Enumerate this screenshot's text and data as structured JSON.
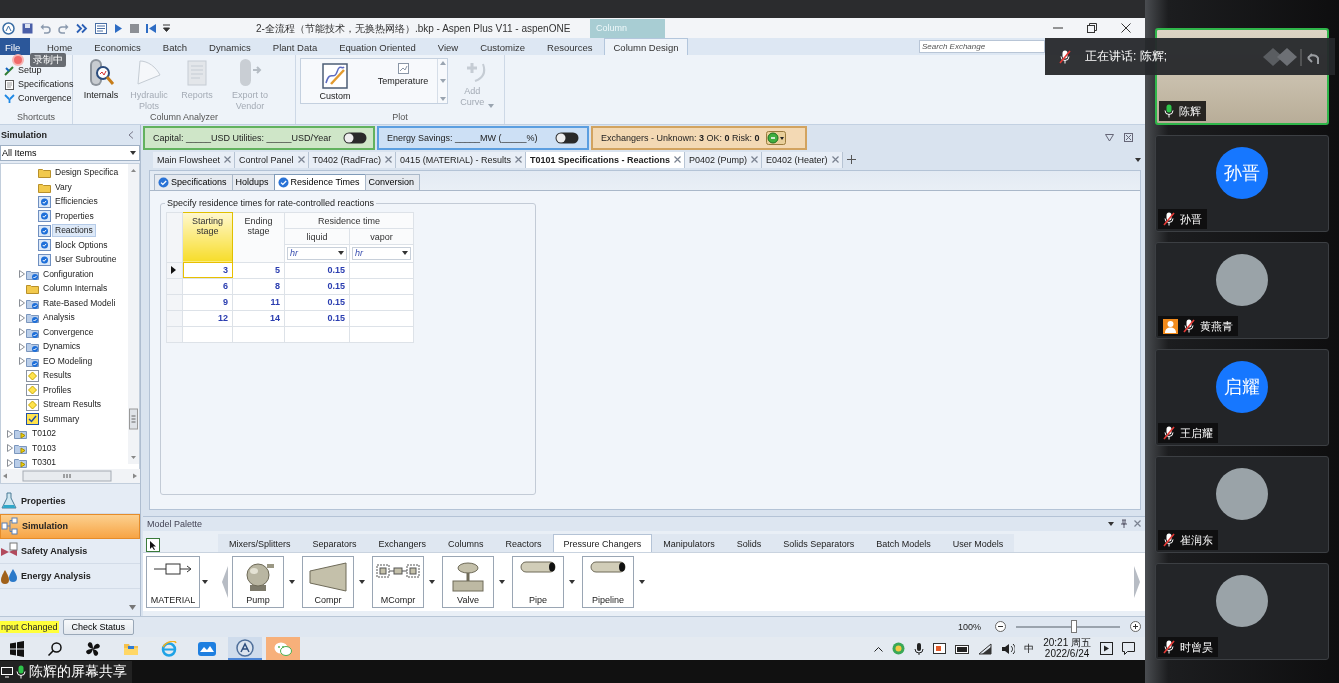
{
  "title_bar": {
    "title": "2-全流程（节能技术，无换热网络）.bkp - Aspen Plus V11 - aspenONE",
    "context_tab": "Column"
  },
  "recording": {
    "label": "录制中"
  },
  "ribbon_tabs": [
    {
      "label": "File",
      "kind": "file",
      "selected": false
    },
    {
      "label": "Home",
      "kind": "tab",
      "selected": false
    },
    {
      "label": "Economics",
      "kind": "tab",
      "selected": false
    },
    {
      "label": "Batch",
      "kind": "tab",
      "selected": false
    },
    {
      "label": "Dynamics",
      "kind": "tab",
      "selected": false
    },
    {
      "label": "Plant Data",
      "kind": "tab",
      "selected": false
    },
    {
      "label": "Equation Oriented",
      "kind": "tab",
      "selected": false
    },
    {
      "label": "View",
      "kind": "tab",
      "selected": false
    },
    {
      "label": "Customize",
      "kind": "tab",
      "selected": false
    },
    {
      "label": "Resources",
      "kind": "tab",
      "selected": false
    },
    {
      "label": "Column Design",
      "kind": "tab",
      "selected": true
    }
  ],
  "search": {
    "placeholder": "Search Exchange"
  },
  "ribbon_groups": [
    {
      "label": "Shortcuts",
      "kind": "small",
      "items": [
        {
          "label": "Setup",
          "disabled": false
        },
        {
          "label": "Specifications",
          "disabled": false
        },
        {
          "label": "Convergence",
          "disabled": false
        }
      ]
    },
    {
      "label": "Column Analyzer",
      "kind": "large",
      "items": [
        {
          "label": "Internals",
          "disabled": false
        },
        {
          "label": "Hydraulic Plots",
          "disabled": true
        },
        {
          "label": "Reports",
          "disabled": true
        },
        {
          "label": "Export to Vendor",
          "disabled": true
        }
      ]
    },
    {
      "label": "Plot",
      "kind": "gallery",
      "items": [
        {
          "label": "Custom",
          "disabled": false
        },
        {
          "label": "Temperature",
          "disabled": false
        },
        {
          "label": "Add Curve",
          "disabled": true
        }
      ]
    }
  ],
  "navigator": {
    "title": "Simulation",
    "filter": "All Items",
    "tree": [
      {
        "children": [
          {
            "children": [
              {
                "label": "Design Specifica",
                "kind": "folder",
                "expandable": false,
                "selected": false
              },
              {
                "label": "Vary",
                "kind": "folder",
                "expandable": false,
                "selected": false
              },
              {
                "label": "Efficiencies",
                "kind": "form",
                "expandable": false,
                "selected": false
              },
              {
                "label": "Properties",
                "kind": "form",
                "expandable": false,
                "selected": false
              },
              {
                "label": "Reactions",
                "kind": "form",
                "expandable": false,
                "selected": true
              },
              {
                "label": "Block Options",
                "kind": "form",
                "expandable": false,
                "selected": false
              },
              {
                "label": "User Subroutine",
                "kind": "form",
                "expandable": false,
                "selected": false
              }
            ]
          },
          {
            "label": "Configuration",
            "kind": "folder-check",
            "expandable": true,
            "selected": false
          },
          {
            "label": "Column Internals",
            "kind": "folder",
            "expandable": false,
            "selected": false
          },
          {
            "label": "Rate-Based Modeli",
            "kind": "folder-check",
            "expandable": true,
            "selected": false
          },
          {
            "label": "Analysis",
            "kind": "folder-check",
            "expandable": true,
            "selected": false
          },
          {
            "label": "Convergence",
            "kind": "folder-check",
            "expandable": true,
            "selected": false
          },
          {
            "label": "Dynamics",
            "kind": "folder-check",
            "expandable": true,
            "selected": false
          },
          {
            "label": "EO Modeling",
            "kind": "folder-check",
            "expandable": true,
            "selected": false
          },
          {
            "label": "Results",
            "kind": "result",
            "expandable": false,
            "selected": false
          },
          {
            "label": "Profiles",
            "kind": "result",
            "expandable": false,
            "selected": false
          },
          {
            "label": "Stream Results",
            "kind": "result",
            "expandable": false,
            "selected": false
          },
          {
            "label": "Summary",
            "kind": "summary",
            "expandable": false,
            "selected": false
          }
        ]
      },
      {
        "label": "T0102",
        "kind": "block",
        "expandable": true,
        "selected": false
      },
      {
        "label": "T0103",
        "kind": "block",
        "expandable": true,
        "selected": false
      },
      {
        "label": "T0301",
        "kind": "block",
        "expandable": true,
        "selected": false
      }
    ],
    "modules": [
      {
        "label": "Properties",
        "selected": false
      },
      {
        "label": "Simulation",
        "selected": true
      },
      {
        "label": "Safety Analysis",
        "selected": false
      },
      {
        "label": "Energy Analysis",
        "selected": false
      }
    ]
  },
  "energy_bar": {
    "panels": [
      {
        "kind": "toggle",
        "text": "Capital: _____USD   Utilities: _____USD/Year",
        "color": "#cfe6c8",
        "on": false
      },
      {
        "kind": "toggle",
        "text": "Energy Savings: _____MW    (_____%)",
        "color": "#cde0f5",
        "on": false
      },
      {
        "kind": "status",
        "text": "Exchangers -   Unknown: **3**   OK: **0**   Risk: **0**",
        "color": "#f3d9b4"
      }
    ]
  },
  "document_tabs": [
    {
      "label": "Main Flowsheet",
      "selected": false
    },
    {
      "label": "Control Panel",
      "selected": false
    },
    {
      "label": "T0402 (RadFrac)",
      "selected": false
    },
    {
      "label": "0415 (MATERIAL) - Results",
      "selected": false
    },
    {
      "label": "T0101 Specifications - Reactions",
      "selected": true
    },
    {
      "label": "P0402 (Pump)",
      "selected": false
    },
    {
      "label": "E0402 (Heater)",
      "selected": false
    }
  ],
  "form_tabs": [
    {
      "label": "Specifications",
      "complete": true,
      "selected": false
    },
    {
      "label": "Holdups",
      "complete": false,
      "selected": false
    },
    {
      "label": "Residence Times",
      "complete": true,
      "selected": true
    },
    {
      "label": "Conversion",
      "complete": false,
      "selected": false
    }
  ],
  "form": {
    "group_title": "Specify residence times for rate-controlled reactions",
    "table": {
      "columns": {
        "start": "Starting stage",
        "end": "Ending stage",
        "group": "Residence time",
        "liquid": "liquid",
        "vapor": "vapor"
      },
      "units": [
        "hr",
        "hr"
      ],
      "rows": [
        {
          "start": "3",
          "end": "5",
          "liquid": "0.15",
          "selected": true
        },
        {
          "start": "6",
          "end": "8",
          "liquid": "0.15",
          "selected": false
        },
        {
          "start": "9",
          "end": "11",
          "liquid": "0.15",
          "selected": false
        },
        {
          "start": "12",
          "end": "14",
          "liquid": "0.15",
          "selected": false
        }
      ]
    }
  },
  "palette": {
    "title": "Model Palette",
    "tabs": [
      {
        "label": "Mixers/Splitters",
        "selected": false
      },
      {
        "label": "Separators",
        "selected": false
      },
      {
        "label": "Exchangers",
        "selected": false
      },
      {
        "label": "Columns",
        "selected": false
      },
      {
        "label": "Reactors",
        "selected": false
      },
      {
        "label": "Pressure Changers",
        "selected": true
      },
      {
        "label": "Manipulators",
        "selected": false
      },
      {
        "label": "Solids",
        "selected": false
      },
      {
        "label": "Solids Separators",
        "selected": false
      },
      {
        "label": "Batch Models",
        "selected": false
      },
      {
        "label": "User Models",
        "selected": false
      }
    ],
    "stream": {
      "label": "MATERIAL"
    },
    "models": [
      {
        "label": "Pump",
        "kind": "pump"
      },
      {
        "label": "Compr",
        "kind": "compr"
      },
      {
        "label": "MCompr",
        "kind": "mcompr"
      },
      {
        "label": "Valve",
        "kind": "valve"
      },
      {
        "label": "Pipe",
        "kind": "pipe"
      },
      {
        "label": "Pipeline",
        "kind": "pipe"
      }
    ]
  },
  "status_bar": {
    "message": "nput Changed",
    "button": "Check Status",
    "zoom": {
      "label": "100%",
      "level": 0.56
    }
  },
  "taskbar": {
    "apps": [
      {
        "kind": "start",
        "active": false,
        "attention": false
      },
      {
        "kind": "search",
        "active": false,
        "attention": false
      },
      {
        "kind": "fan",
        "active": false,
        "attention": false
      },
      {
        "kind": "folder",
        "active": false,
        "attention": false
      },
      {
        "kind": "browser",
        "active": false,
        "attention": false
      },
      {
        "kind": "cloud",
        "active": false,
        "attention": false
      },
      {
        "kind": "aspen",
        "active": true,
        "attention": false
      },
      {
        "kind": "chat",
        "active": false,
        "attention": true
      }
    ],
    "tray": {
      "ime": "中",
      "time": "20:21 周五",
      "date": "2022/6/24"
    }
  },
  "screen_share": {
    "label": "陈辉的屏幕共享"
  },
  "meeting": {
    "banner": "正在讲话: 陈辉;",
    "participants": [
      {
        "name": "陈辉",
        "kind": "video",
        "muted": false,
        "speaking": true,
        "badge": false
      },
      {
        "name": "孙晋",
        "kind": "initials",
        "initials": "孙晋",
        "muted": true,
        "speaking": false,
        "badge": false
      },
      {
        "name": "黄燕青",
        "kind": "photo",
        "muted": true,
        "speaking": false,
        "badge": true
      },
      {
        "name": "王启耀",
        "kind": "initials",
        "initials": "启耀",
        "muted": true,
        "speaking": false,
        "badge": false
      },
      {
        "name": "崔润东",
        "kind": "photo",
        "muted": true,
        "speaking": false,
        "badge": false
      },
      {
        "name": "时曾昊",
        "kind": "photo",
        "muted": true,
        "speaking": false,
        "badge": false
      }
    ]
  }
}
